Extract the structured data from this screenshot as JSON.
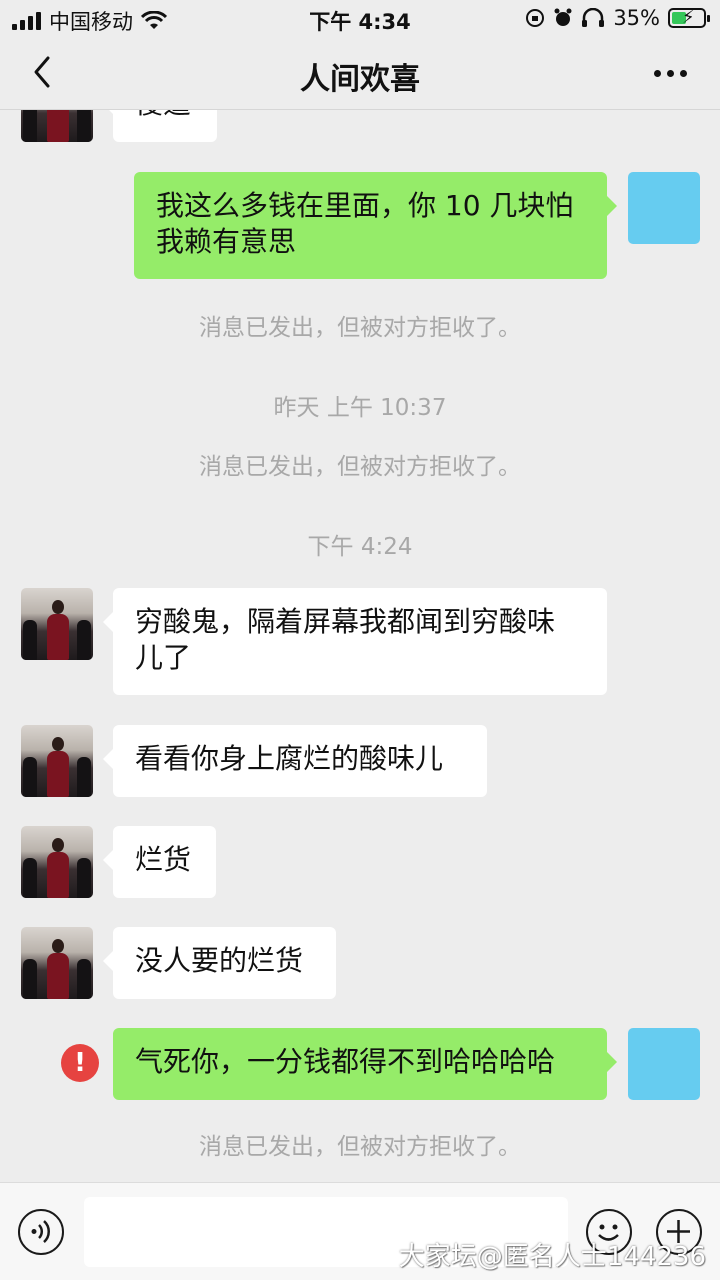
{
  "status_bar": {
    "carrier": "中国移动",
    "time": "下午 4:34",
    "battery_percent": "35%"
  },
  "nav": {
    "title": "人间欢喜"
  },
  "messages": {
    "m0": "傻逼",
    "m1_line1": "我这么多钱在里面，你 10 几块怕",
    "m1_line2": "我赖有意思",
    "sys1": "消息已发出，但被对方拒收了。",
    "time1": "昨天 上午 10:37",
    "sys2": "消息已发出，但被对方拒收了。",
    "time2": "下午 4:24",
    "m2_line1": "穷酸鬼，隔着屏幕我都闻到穷酸味",
    "m2_line2": "儿了",
    "m3": "看看你身上腐烂的酸味儿",
    "m4": "烂货",
    "m5": "没人要的烂货",
    "m6": "气死你，一分钱都得不到哈哈哈哈",
    "sys3": "消息已发出，但被对方拒收了。",
    "error_mark": "!"
  },
  "watermark": "大家坛@匿名人士144236",
  "colors": {
    "background": "#ededed",
    "outgoing_bubble": "#95ec69",
    "incoming_bubble": "#ffffff",
    "self_avatar": "#66ccf0",
    "error": "#e64340"
  },
  "icons": [
    "back-chevron-icon",
    "more-dots-icon",
    "voice-icon",
    "emoji-icon",
    "plus-icon",
    "wifi-icon",
    "alarm-icon",
    "headphones-icon",
    "battery-icon"
  ]
}
